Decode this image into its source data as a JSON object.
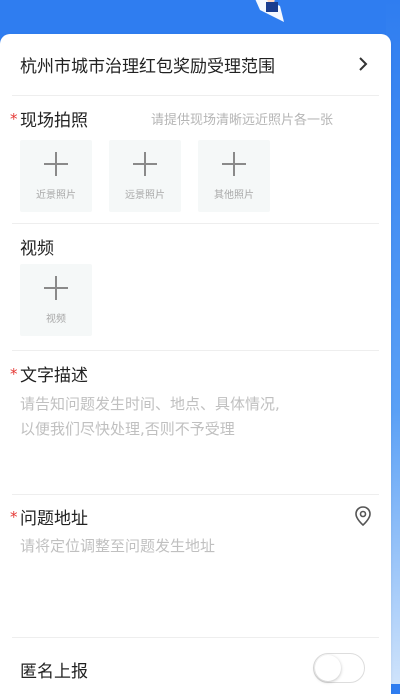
{
  "range_row": {
    "label": "杭州市城市治理红包奖励受理范围"
  },
  "photos": {
    "required_mark": "*",
    "title": "现场拍照",
    "hint": "请提供现场清晰远近照片各一张",
    "tiles": [
      {
        "caption": "近景照片"
      },
      {
        "caption": "远景照片"
      },
      {
        "caption": "其他照片"
      }
    ]
  },
  "video": {
    "title": "视频",
    "tile": {
      "caption": "视频"
    }
  },
  "description": {
    "required_mark": "*",
    "title": "文字描述",
    "placeholder_line1": "请告知问题发生时间、地点、具体情况,",
    "placeholder_line2": "以便我们尽快处理,否则不予受理"
  },
  "address": {
    "required_mark": "*",
    "title": "问题地址",
    "placeholder": "请将定位调整至问题发生地址"
  },
  "anonymous": {
    "title": "匿名上报",
    "enabled": false
  },
  "colors": {
    "header_blue": "#2f7df0",
    "required_red": "#e53935",
    "placeholder_gray": "#c0c0c0"
  }
}
